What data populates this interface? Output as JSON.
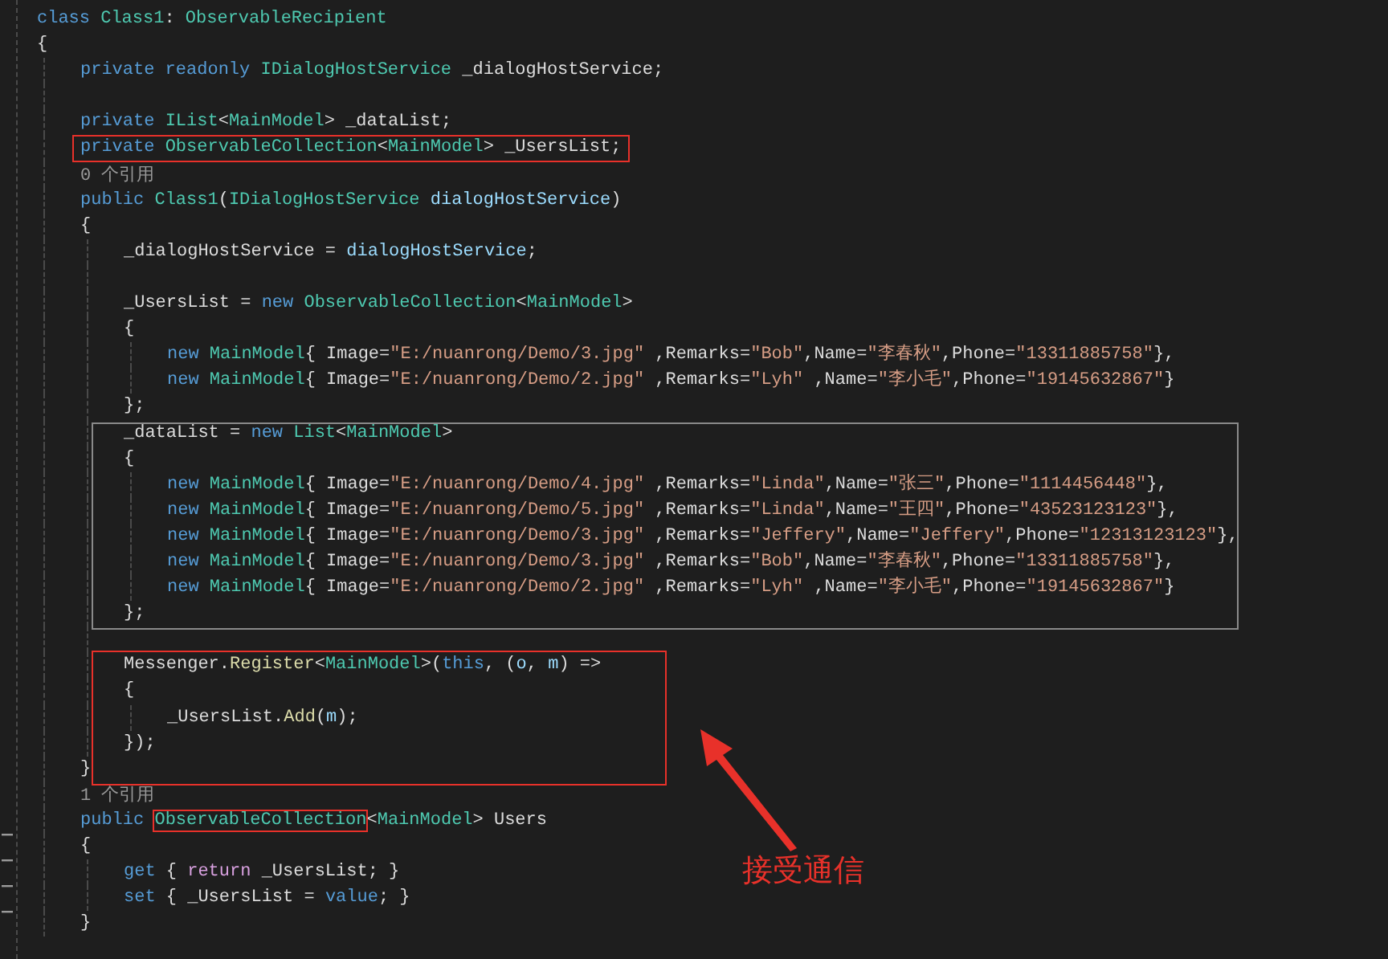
{
  "code": [
    {
      "kind": "line",
      "tokens": [
        {
          "kind": "keyword",
          "text": "class "
        },
        {
          "kind": "type",
          "text": "Class1"
        },
        {
          "kind": "plain",
          "text": ": "
        },
        {
          "kind": "type",
          "text": "ObservableRecipient"
        }
      ]
    },
    {
      "kind": "line",
      "tokens": [
        {
          "kind": "plain",
          "text": "{"
        }
      ]
    },
    {
      "kind": "block",
      "children": [
        {
          "kind": "line",
          "tokens": [
            {
              "kind": "keyword",
              "text": "private readonly "
            },
            {
              "kind": "type",
              "text": "IDialogHostService"
            },
            {
              "kind": "plain",
              "text": " _dialogHostService;"
            }
          ]
        },
        {
          "kind": "blank"
        },
        {
          "kind": "line",
          "tokens": [
            {
              "kind": "keyword",
              "text": "private "
            },
            {
              "kind": "type",
              "text": "IList"
            },
            {
              "kind": "plain",
              "text": "<"
            },
            {
              "kind": "type",
              "text": "MainModel"
            },
            {
              "kind": "plain",
              "text": "> _dataList;"
            }
          ]
        },
        {
          "kind": "line",
          "framed": true,
          "tokens": [
            {
              "kind": "keyword",
              "text": "private "
            },
            {
              "kind": "type",
              "text": "ObservableCollection"
            },
            {
              "kind": "plain",
              "text": "<"
            },
            {
              "kind": "type",
              "text": "MainModel"
            },
            {
              "kind": "plain",
              "text": "> _UsersList;"
            }
          ]
        },
        {
          "kind": "lens",
          "text": "0 个引用"
        },
        {
          "kind": "line",
          "tokens": [
            {
              "kind": "keyword",
              "text": "public "
            },
            {
              "kind": "type",
              "text": "Class1"
            },
            {
              "kind": "plain",
              "text": "("
            },
            {
              "kind": "type",
              "text": "IDialogHostService"
            },
            {
              "kind": "param",
              "text": " dialogHostService"
            },
            {
              "kind": "plain",
              "text": ")"
            }
          ]
        },
        {
          "kind": "line",
          "tokens": [
            {
              "kind": "plain",
              "text": "{"
            }
          ]
        },
        {
          "kind": "block",
          "children": [
            {
              "kind": "line",
              "tokens": [
                {
                  "kind": "plain",
                  "text": "_dialogHostService = "
                },
                {
                  "kind": "param",
                  "text": "dialogHostService"
                },
                {
                  "kind": "plain",
                  "text": ";"
                }
              ]
            },
            {
              "kind": "blank"
            },
            {
              "kind": "line",
              "tokens": [
                {
                  "kind": "plain",
                  "text": "_UsersList = "
                },
                {
                  "kind": "keyword",
                  "text": "new "
                },
                {
                  "kind": "type",
                  "text": "ObservableCollection"
                },
                {
                  "kind": "plain",
                  "text": "<"
                },
                {
                  "kind": "type",
                  "text": "MainModel"
                },
                {
                  "kind": "plain",
                  "text": ">"
                }
              ]
            },
            {
              "kind": "line",
              "tokens": [
                {
                  "kind": "plain",
                  "text": "{"
                }
              ]
            },
            {
              "kind": "block",
              "children": [
                {
                  "kind": "line",
                  "tokens": [
                    {
                      "kind": "keyword",
                      "text": "new "
                    },
                    {
                      "kind": "type",
                      "text": "MainModel"
                    },
                    {
                      "kind": "plain",
                      "text": "{ Image="
                    },
                    {
                      "kind": "string",
                      "text": "\"E:/nuanrong/Demo/3.jpg\""
                    },
                    {
                      "kind": "plain",
                      "text": " ,Remarks="
                    },
                    {
                      "kind": "string",
                      "text": "\"Bob\""
                    },
                    {
                      "kind": "plain",
                      "text": ",Name="
                    },
                    {
                      "kind": "string",
                      "text": "\"李春秋\""
                    },
                    {
                      "kind": "plain",
                      "text": ",Phone="
                    },
                    {
                      "kind": "string",
                      "text": "\"13311885758\""
                    },
                    {
                      "kind": "plain",
                      "text": "},"
                    }
                  ]
                },
                {
                  "kind": "line",
                  "tokens": [
                    {
                      "kind": "keyword",
                      "text": "new "
                    },
                    {
                      "kind": "type",
                      "text": "MainModel"
                    },
                    {
                      "kind": "plain",
                      "text": "{ Image="
                    },
                    {
                      "kind": "string",
                      "text": "\"E:/nuanrong/Demo/2.jpg\""
                    },
                    {
                      "kind": "plain",
                      "text": " ,Remarks="
                    },
                    {
                      "kind": "string",
                      "text": "\"Lyh\""
                    },
                    {
                      "kind": "plain",
                      "text": " ,Name="
                    },
                    {
                      "kind": "string",
                      "text": "\"李小毛\""
                    },
                    {
                      "kind": "plain",
                      "text": ",Phone="
                    },
                    {
                      "kind": "string",
                      "text": "\"19145632867\""
                    },
                    {
                      "kind": "plain",
                      "text": "}"
                    }
                  ]
                }
              ]
            },
            {
              "kind": "line",
              "tokens": [
                {
                  "kind": "plain",
                  "text": "};"
                }
              ]
            },
            {
              "kind": "line",
              "tokens": [
                {
                  "kind": "plain",
                  "text": "_dataList = "
                },
                {
                  "kind": "keyword",
                  "text": "new "
                },
                {
                  "kind": "type",
                  "text": "List"
                },
                {
                  "kind": "plain",
                  "text": "<"
                },
                {
                  "kind": "type",
                  "text": "MainModel"
                },
                {
                  "kind": "plain",
                  "text": ">"
                }
              ]
            },
            {
              "kind": "line",
              "tokens": [
                {
                  "kind": "plain",
                  "text": "{"
                }
              ]
            },
            {
              "kind": "block",
              "children": [
                {
                  "kind": "line",
                  "tokens": [
                    {
                      "kind": "keyword",
                      "text": "new "
                    },
                    {
                      "kind": "type",
                      "text": "MainModel"
                    },
                    {
                      "kind": "plain",
                      "text": "{ Image="
                    },
                    {
                      "kind": "string",
                      "text": "\"E:/nuanrong/Demo/4.jpg\""
                    },
                    {
                      "kind": "plain",
                      "text": " ,Remarks="
                    },
                    {
                      "kind": "string",
                      "text": "\"Linda\""
                    },
                    {
                      "kind": "plain",
                      "text": ",Name="
                    },
                    {
                      "kind": "string",
                      "text": "\"张三\""
                    },
                    {
                      "kind": "plain",
                      "text": ",Phone="
                    },
                    {
                      "kind": "string",
                      "text": "\"1114456448\""
                    },
                    {
                      "kind": "plain",
                      "text": "},"
                    }
                  ]
                },
                {
                  "kind": "line",
                  "tokens": [
                    {
                      "kind": "keyword",
                      "text": "new "
                    },
                    {
                      "kind": "type",
                      "text": "MainModel"
                    },
                    {
                      "kind": "plain",
                      "text": "{ Image="
                    },
                    {
                      "kind": "string",
                      "text": "\"E:/nuanrong/Demo/5.jpg\""
                    },
                    {
                      "kind": "plain",
                      "text": " ,Remarks="
                    },
                    {
                      "kind": "string",
                      "text": "\"Linda\""
                    },
                    {
                      "kind": "plain",
                      "text": ",Name="
                    },
                    {
                      "kind": "string",
                      "text": "\"王四\""
                    },
                    {
                      "kind": "plain",
                      "text": ",Phone="
                    },
                    {
                      "kind": "string",
                      "text": "\"43523123123\""
                    },
                    {
                      "kind": "plain",
                      "text": "},"
                    }
                  ]
                },
                {
                  "kind": "line",
                  "tokens": [
                    {
                      "kind": "keyword",
                      "text": "new "
                    },
                    {
                      "kind": "type",
                      "text": "MainModel"
                    },
                    {
                      "kind": "plain",
                      "text": "{ Image="
                    },
                    {
                      "kind": "string",
                      "text": "\"E:/nuanrong/Demo/3.jpg\""
                    },
                    {
                      "kind": "plain",
                      "text": " ,Remarks="
                    },
                    {
                      "kind": "string",
                      "text": "\"Jeffery\""
                    },
                    {
                      "kind": "plain",
                      "text": ",Name="
                    },
                    {
                      "kind": "string",
                      "text": "\"Jeffery\""
                    },
                    {
                      "kind": "plain",
                      "text": ",Phone="
                    },
                    {
                      "kind": "string",
                      "text": "\"12313123123\""
                    },
                    {
                      "kind": "plain",
                      "text": "},"
                    }
                  ]
                },
                {
                  "kind": "line",
                  "tokens": [
                    {
                      "kind": "keyword",
                      "text": "new "
                    },
                    {
                      "kind": "type",
                      "text": "MainModel"
                    },
                    {
                      "kind": "plain",
                      "text": "{ Image="
                    },
                    {
                      "kind": "string",
                      "text": "\"E:/nuanrong/Demo/3.jpg\""
                    },
                    {
                      "kind": "plain",
                      "text": " ,Remarks="
                    },
                    {
                      "kind": "string",
                      "text": "\"Bob\""
                    },
                    {
                      "kind": "plain",
                      "text": ",Name="
                    },
                    {
                      "kind": "string",
                      "text": "\"李春秋\""
                    },
                    {
                      "kind": "plain",
                      "text": ",Phone="
                    },
                    {
                      "kind": "string",
                      "text": "\"13311885758\""
                    },
                    {
                      "kind": "plain",
                      "text": "},"
                    }
                  ]
                },
                {
                  "kind": "line",
                  "tokens": [
                    {
                      "kind": "keyword",
                      "text": "new "
                    },
                    {
                      "kind": "type",
                      "text": "MainModel"
                    },
                    {
                      "kind": "plain",
                      "text": "{ Image="
                    },
                    {
                      "kind": "string",
                      "text": "\"E:/nuanrong/Demo/2.jpg\""
                    },
                    {
                      "kind": "plain",
                      "text": " ,Remarks="
                    },
                    {
                      "kind": "string",
                      "text": "\"Lyh\""
                    },
                    {
                      "kind": "plain",
                      "text": " ,Name="
                    },
                    {
                      "kind": "string",
                      "text": "\"李小毛\""
                    },
                    {
                      "kind": "plain",
                      "text": ",Phone="
                    },
                    {
                      "kind": "string",
                      "text": "\"19145632867\""
                    },
                    {
                      "kind": "plain",
                      "text": "}"
                    }
                  ]
                }
              ]
            },
            {
              "kind": "line",
              "tokens": [
                {
                  "kind": "plain",
                  "text": "};"
                }
              ]
            },
            {
              "kind": "blank"
            },
            {
              "kind": "line",
              "tokens": [
                {
                  "kind": "plain",
                  "text": "Messenger."
                },
                {
                  "kind": "method",
                  "text": "Register"
                },
                {
                  "kind": "plain",
                  "text": "<"
                },
                {
                  "kind": "type",
                  "text": "MainModel"
                },
                {
                  "kind": "plain",
                  "text": ">("
                },
                {
                  "kind": "keyword",
                  "text": "this"
                },
                {
                  "kind": "plain",
                  "text": ", ("
                },
                {
                  "kind": "param",
                  "text": "o"
                },
                {
                  "kind": "plain",
                  "text": ", "
                },
                {
                  "kind": "param",
                  "text": "m"
                },
                {
                  "kind": "plain",
                  "text": ") =>"
                }
              ]
            },
            {
              "kind": "line",
              "tokens": [
                {
                  "kind": "plain",
                  "text": "{"
                }
              ]
            },
            {
              "kind": "block",
              "children": [
                {
                  "kind": "line",
                  "tokens": [
                    {
                      "kind": "plain",
                      "text": "_UsersList."
                    },
                    {
                      "kind": "method",
                      "text": "Add"
                    },
                    {
                      "kind": "plain",
                      "text": "("
                    },
                    {
                      "kind": "param",
                      "text": "m"
                    },
                    {
                      "kind": "plain",
                      "text": ");"
                    }
                  ]
                }
              ]
            },
            {
              "kind": "line",
              "tokens": [
                {
                  "kind": "plain",
                  "text": "});"
                }
              ]
            }
          ]
        },
        {
          "kind": "line",
          "tokens": [
            {
              "kind": "plain",
              "text": "}"
            }
          ]
        },
        {
          "kind": "lens",
          "text": "1 个引用"
        },
        {
          "kind": "line",
          "tokens": [
            {
              "kind": "keyword",
              "text": "public "
            },
            {
              "kind": "type",
              "text": "ObservableCollection",
              "framed": true
            },
            {
              "kind": "plain",
              "text": "<"
            },
            {
              "kind": "type",
              "text": "MainModel"
            },
            {
              "kind": "plain",
              "text": "> Users"
            }
          ]
        },
        {
          "kind": "line",
          "tokens": [
            {
              "kind": "plain",
              "text": "{"
            }
          ]
        },
        {
          "kind": "block",
          "children": [
            {
              "kind": "line",
              "tokens": [
                {
                  "kind": "keyword",
                  "text": "get "
                },
                {
                  "kind": "plain",
                  "text": "{ "
                },
                {
                  "kind": "control",
                  "text": "return "
                },
                {
                  "kind": "plain",
                  "text": "_UsersList; }"
                }
              ]
            },
            {
              "kind": "line",
              "tokens": [
                {
                  "kind": "keyword",
                  "text": "set "
                },
                {
                  "kind": "plain",
                  "text": "{ _UsersList = "
                },
                {
                  "kind": "keyword",
                  "text": "value"
                },
                {
                  "kind": "plain",
                  "text": "; }"
                }
              ]
            }
          ]
        },
        {
          "kind": "line",
          "tokens": [
            {
              "kind": "plain",
              "text": "}"
            }
          ]
        }
      ]
    }
  ],
  "annotation": {
    "label": "接受通信"
  }
}
